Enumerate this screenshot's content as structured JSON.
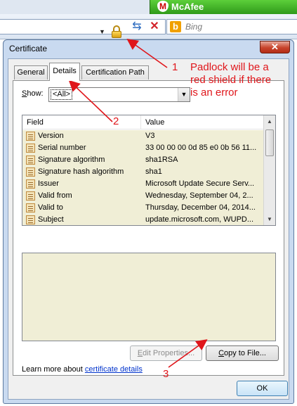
{
  "browser": {
    "mcafee_label": "McAfee",
    "mcafee_logo_letter": "M",
    "search_placeholder": "Bing",
    "bing_logo_letter": "b",
    "refresh_glyph": "⇆",
    "stop_glyph": "✕",
    "icons": [
      "padlock-icon",
      "refresh-icon",
      "stop-icon",
      "bing-icon",
      "mcafee-icon"
    ]
  },
  "dialog": {
    "title": "Certificate",
    "close_glyph": "✕",
    "tabs": [
      {
        "label": "General"
      },
      {
        "label": "Details"
      },
      {
        "label": "Certification Path"
      }
    ],
    "active_tab": "Details",
    "show_label_prefix": "S",
    "show_label_rest": "how:",
    "show_value": "<All>",
    "columns": {
      "field": "Field",
      "value": "Value"
    },
    "rows": [
      {
        "field": "Version",
        "value": "V3"
      },
      {
        "field": "Serial number",
        "value": "33 00 00 00 0d 85 e0 0b 56 11..."
      },
      {
        "field": "Signature algorithm",
        "value": "sha1RSA"
      },
      {
        "field": "Signature hash algorithm",
        "value": "sha1"
      },
      {
        "field": "Issuer",
        "value": "Microsoft Update Secure Serv..."
      },
      {
        "field": "Valid from",
        "value": "Wednesday, September 04, 2..."
      },
      {
        "field": "Valid to",
        "value": "Thursday, December 04, 2014..."
      },
      {
        "field": "Subject",
        "value": "update.microsoft.com, WUPD..."
      }
    ],
    "edit_properties_prefix": "E",
    "edit_properties_rest": "dit Properties...",
    "copy_to_file_prefix": "C",
    "copy_to_file_rest": "opy to File...",
    "learn_more_text": "Learn more about ",
    "learn_more_link": "certificate details",
    "ok_label": "OK"
  },
  "annotations": {
    "note_1_number": "1",
    "note_1_line1": "Padlock will be a",
    "note_1_line2": "red shield if there",
    "note_1_line3": "is an error",
    "note_2_number": "2",
    "note_3_number": "3"
  },
  "colors": {
    "annotation": "#e0161b",
    "list_background": "#f0eed6",
    "mcafee_green": "#3fae24",
    "link": "#0033cc"
  }
}
